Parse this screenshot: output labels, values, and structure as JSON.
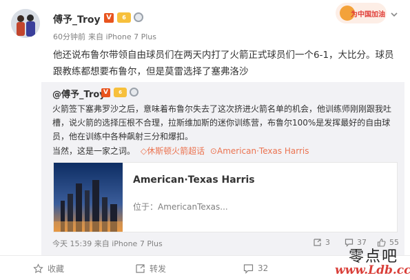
{
  "post": {
    "author": "傅予_Troy",
    "verified_badge": "V",
    "level_badge": "6",
    "time": "60分钟前",
    "source": "来自 iPhone 7 Plus",
    "text": "他还说布鲁尔带领自由球员们在两天内打了火箭正式球员们一个6-1，大比分。球员跟教练都想要布鲁尔，但是莫雷选择了塞弗洛沙",
    "promo_label": "为中国加油"
  },
  "repost": {
    "author": "@傅予_Troy",
    "verified_badge": "V",
    "level_badge": "6",
    "text": "火箭签下塞弗罗沙之后，意味着布鲁尔失去了这次挤进火箭名单的机会，他训练师刚刚跟我吐槽，说火箭的选择压根不合理，拉斯维加斯的迷你训练营，布鲁尔100%是发挥最好的自由球员，他在训练中各种飙射三分和爆扣。",
    "closing": "当然，这是一家之词。",
    "topic": "休斯顿火箭超话",
    "location": "American·Texas Harris",
    "link_card": {
      "title": "American·Texas Harris",
      "subtitle": "位于：AmericanTexas..."
    },
    "time": "今天 15:39",
    "source": "来自 iPhone 7 Plus",
    "reposts": "3",
    "comments": "37",
    "likes": "55"
  },
  "actions": {
    "favorite": "收藏",
    "repost": "转发",
    "comment_count": "32"
  },
  "watermark": {
    "cn": "零点吧",
    "url": "www.Ldb.cc"
  },
  "colors": {
    "accent": "#eb7350",
    "muted": "#808080",
    "quote_bg": "#f2f2f5"
  }
}
